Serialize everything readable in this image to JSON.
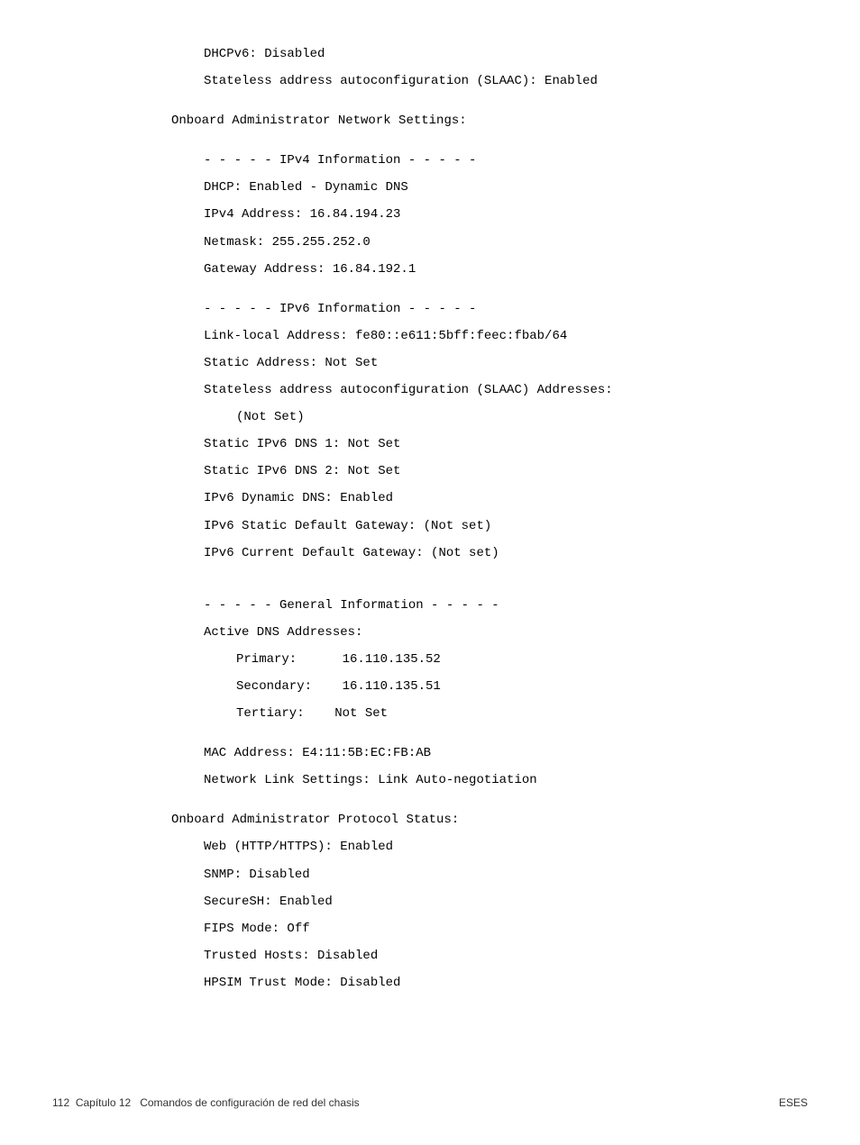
{
  "lines": {
    "l1": "DHCPv6: Disabled",
    "l2": "Stateless address autoconfiguration (SLAAC): Enabled",
    "l3": "Onboard Administrator Network Settings:",
    "l4": "- - - - - IPv4 Information - - - - -",
    "l5": "DHCP: Enabled - Dynamic DNS",
    "l6": "IPv4 Address: 16.84.194.23",
    "l7": "Netmask: 255.255.252.0",
    "l8": "Gateway Address: 16.84.192.1",
    "l9": "- - - - - IPv6 Information - - - - -",
    "l10": "Link-local Address: fe80::e611:5bff:feec:fbab/64",
    "l11": "Static Address: Not Set",
    "l12": "Stateless address autoconfiguration (SLAAC) Addresses:",
    "l13": "(Not Set)",
    "l14": "Static IPv6 DNS 1: Not Set",
    "l15": "Static IPv6 DNS 2: Not Set",
    "l16": "IPv6 Dynamic DNS: Enabled",
    "l17": "IPv6 Static Default Gateway: (Not set)",
    "l18": "IPv6 Current Default Gateway: (Not set)",
    "l19": "- - - - - General Information - - - - -",
    "l20": "Active DNS Addresses:",
    "l21": "Primary:      16.110.135.52",
    "l22": "Secondary:    16.110.135.51",
    "l23": "Tertiary:    Not Set",
    "l24": "MAC Address: E4:11:5B:EC:FB:AB",
    "l25": "Network Link Settings: Link Auto-negotiation",
    "l26": "Onboard Administrator Protocol Status:",
    "l27": "Web (HTTP/HTTPS): Enabled",
    "l28": "SNMP: Disabled",
    "l29": "SecureSH: Enabled",
    "l30": "FIPS Mode: Off",
    "l31": "Trusted Hosts: Disabled",
    "l32": "HPSIM Trust Mode: Disabled"
  },
  "footer": {
    "page_number": "112",
    "chapter": "Capítulo 12   Comandos de configuración de red del chasis",
    "right": "ESES"
  }
}
